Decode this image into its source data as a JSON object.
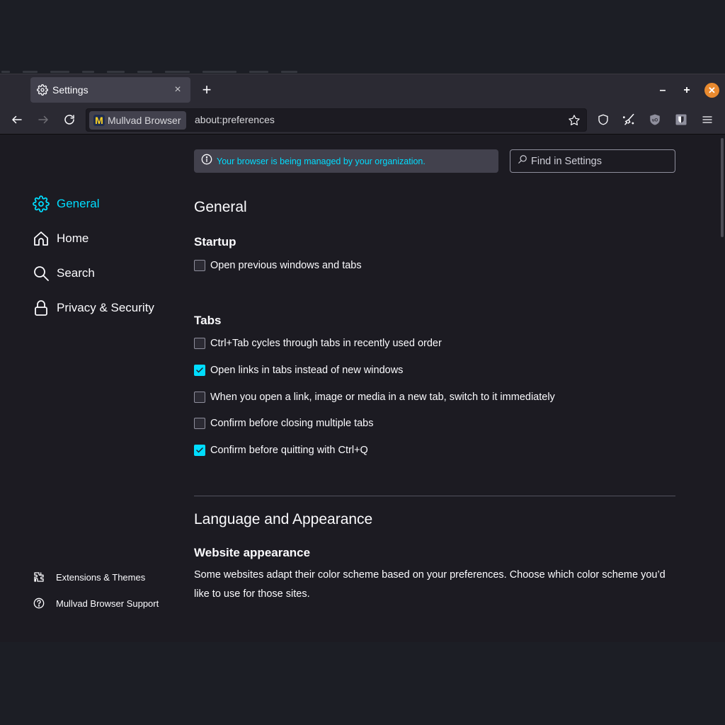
{
  "window": {
    "minimize_label": "–",
    "maximize_label": "+",
    "close_label": "✕"
  },
  "tabs": [
    {
      "title": "Settings",
      "icon": "gear-icon",
      "close_label": "×",
      "active": true
    }
  ],
  "newtab_label": "+",
  "navbar": {
    "identity_label": "Mullvad Browser",
    "identity_logo_letter": "M",
    "url": "about:preferences",
    "toolbar_icons": [
      "shield-icon",
      "broom-icon",
      "ublock-origin-icon",
      "noscript-icon",
      "hamburger-menu-icon"
    ]
  },
  "colors": {
    "accent": "#00ddff",
    "close_button": "#e98a2f",
    "background": "#1c1b22",
    "chrome": "#2b2a33"
  },
  "banner": {
    "message": "Your browser is being managed by your organization.",
    "icon": "info-icon"
  },
  "search": {
    "placeholder": "Find in Settings",
    "value": ""
  },
  "sidebar": {
    "items": [
      {
        "label": "General",
        "icon": "gear-icon",
        "active": true
      },
      {
        "label": "Home",
        "icon": "home-icon",
        "active": false
      },
      {
        "label": "Search",
        "icon": "search-icon",
        "active": false
      },
      {
        "label": "Privacy & Security",
        "icon": "lock-icon",
        "active": false
      }
    ],
    "footer": [
      {
        "label": "Extensions & Themes",
        "icon": "puzzle-icon"
      },
      {
        "label": "Mullvad Browser Support",
        "icon": "help-icon"
      }
    ]
  },
  "main": {
    "title": "General",
    "startup": {
      "heading": "Startup",
      "options": [
        {
          "label": "Open previous windows and tabs",
          "checked": false
        }
      ]
    },
    "tabs_section": {
      "heading": "Tabs",
      "options": [
        {
          "label": "Ctrl+Tab cycles through tabs in recently used order",
          "checked": false
        },
        {
          "label": "Open links in tabs instead of new windows",
          "checked": true
        },
        {
          "label": "When you open a link, image or media in a new tab, switch to it immediately",
          "checked": false
        },
        {
          "label": "Confirm before closing multiple tabs",
          "checked": false
        },
        {
          "label": "Confirm before quitting with Ctrl+Q",
          "checked": true
        }
      ]
    },
    "language": {
      "title": "Language and Appearance",
      "website_appearance": {
        "heading": "Website appearance",
        "description": "Some websites adapt their color scheme based on your preferences. Choose which color scheme you’d like to use for those sites.",
        "schemes": [
          {
            "variant": "dark"
          },
          {
            "variant": "dark"
          },
          {
            "variant": "light"
          },
          {
            "variant": "dark"
          }
        ]
      }
    }
  }
}
